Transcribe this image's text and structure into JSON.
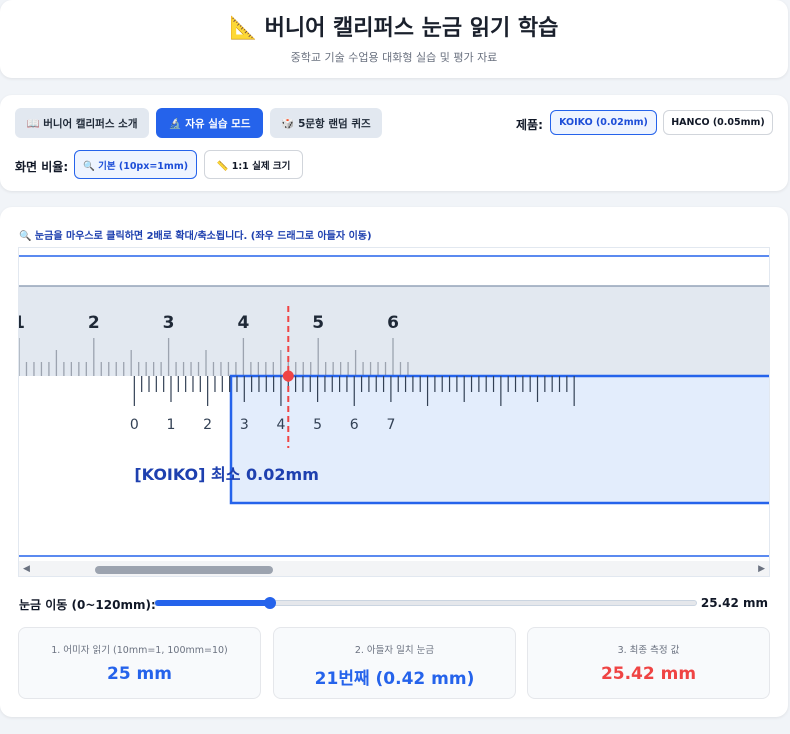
{
  "header": {
    "title": "📐 버니어 캘리퍼스 눈금 읽기 학습",
    "subtitle": "중학교 기술 수업용 대화형 실습 및 평가 자료"
  },
  "modes": {
    "intro": "📖 버니어 캘리퍼스 소개",
    "practice": "🔬 자유 실습 모드",
    "quiz": "🎲 5문항 랜덤 퀴즈"
  },
  "product": {
    "label": "제품:",
    "koiko": "KOIKO (0.02mm)",
    "hanco": "HANCO (0.05mm)"
  },
  "ratio": {
    "label": "화면 비율:",
    "base": "🔍 기본 (10px=1mm)",
    "real": "📏 1:1 실제 크기"
  },
  "hint": "🔍 눈금을 마우스로 클릭하면 2배로 확대/축소됩니다. (좌우 드래그로 아들자 이동)",
  "scale": {
    "main_numbers": [
      "1",
      "2",
      "3",
      "4",
      "5",
      "6"
    ],
    "vernier_numbers": [
      "0",
      "1",
      "2",
      "3",
      "4",
      "5",
      "6",
      "7"
    ],
    "vernier_caption": "[KOIKO] 최소 0.02mm",
    "reading_mm": 25.42,
    "match_index": 21
  },
  "slider": {
    "label": "눈금 이동 (0~120mm):",
    "value_text": "25.42 mm",
    "min": 0,
    "max": 120,
    "value": 25.42
  },
  "results": {
    "main": {
      "label": "1. 어미자 읽기 (10mm=1, 100mm=10)",
      "value": "25 mm"
    },
    "vernier": {
      "label": "2. 아들자 일치 눈금",
      "value": "21번째 (0.42 mm)"
    },
    "final": {
      "label": "3. 최종 측정 값",
      "value": "25.42 mm"
    }
  },
  "colors": {
    "primary": "#2563eb",
    "main_scale_bg": "#e2e8f0",
    "vernier_bg": "#e3edfc",
    "match_red": "#ef4444"
  }
}
